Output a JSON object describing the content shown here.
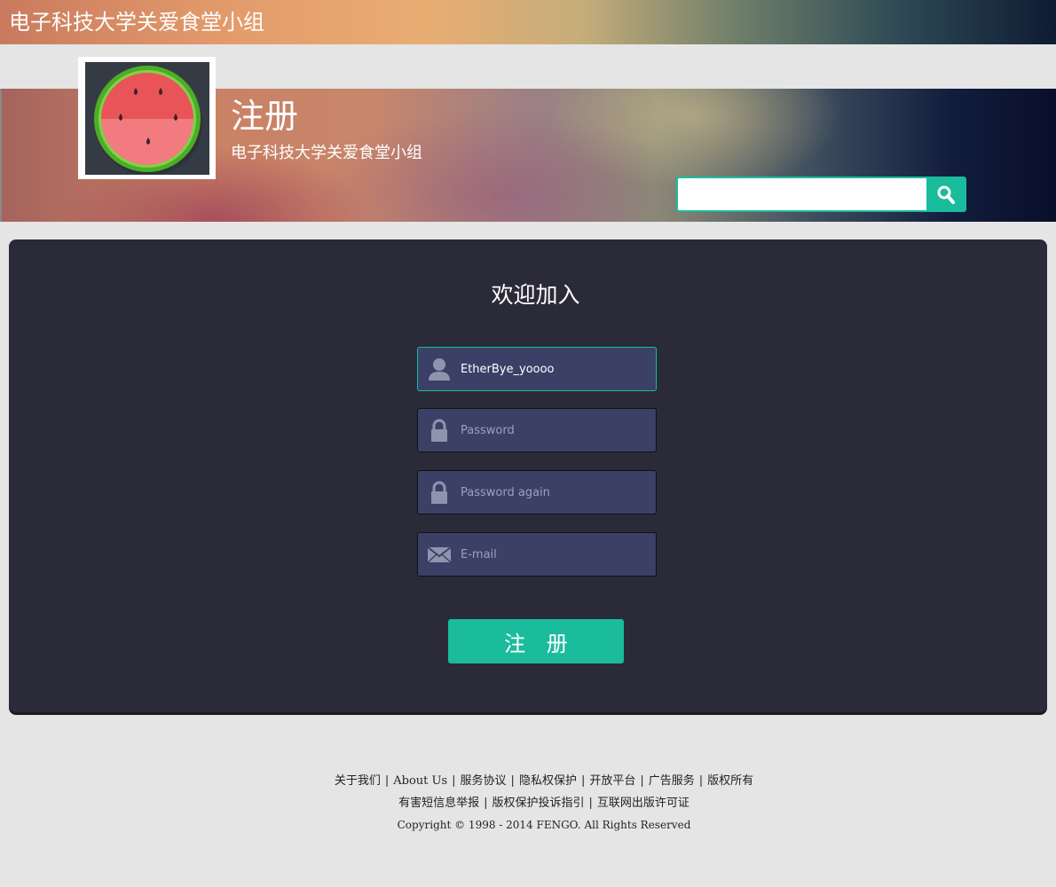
{
  "topbar": {
    "title": "电子科技大学关爱食堂小组"
  },
  "banner": {
    "title": "注册",
    "subtitle": "电子科技大学关爱食堂小组",
    "logo_icon": "watermelon-icon"
  },
  "search": {
    "value": "",
    "button_icon": "search-icon"
  },
  "form": {
    "heading": "欢迎加入",
    "username": {
      "value": "EtherBye_yoooo",
      "icon": "user-icon"
    },
    "password": {
      "placeholder": "Password",
      "icon": "lock-icon"
    },
    "password_again": {
      "placeholder": "Password again",
      "icon": "lock-icon"
    },
    "email": {
      "placeholder": "E-mail",
      "icon": "mail-icon"
    },
    "submit_label": "注 册"
  },
  "footer": {
    "links_row1": [
      "关于我们",
      "About Us",
      "服务协议",
      "隐私权保护",
      "开放平台",
      "广告服务",
      "版权所有"
    ],
    "links_row2": [
      "有害短信息举报",
      "版权保护投诉指引",
      "互联网出版许可证"
    ],
    "copyright": "Copyright © 1998 - 2014 FENGO. All Rights Reserved"
  },
  "colors": {
    "accent": "#1abc9c",
    "panel": "#2b2a38",
    "field": "#3b4067",
    "page_bg": "#e5e5e5"
  }
}
